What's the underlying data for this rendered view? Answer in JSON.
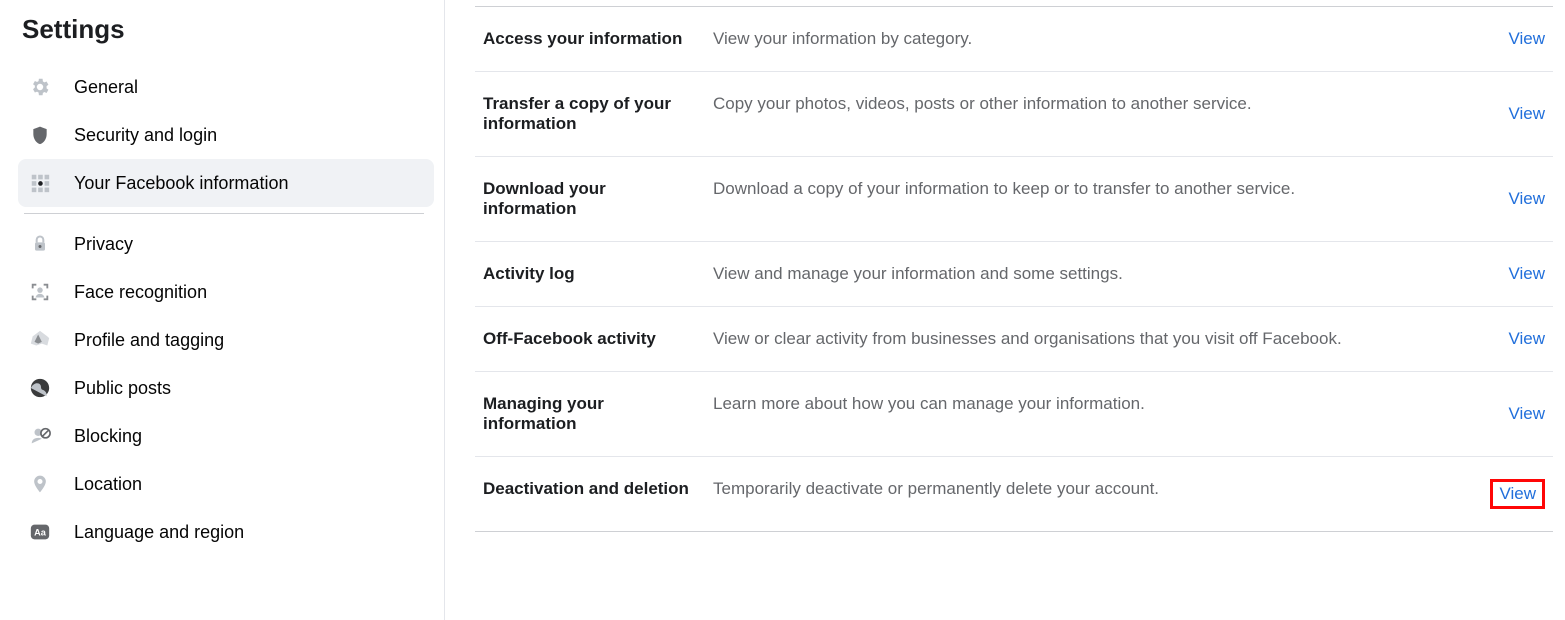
{
  "sidebar": {
    "title": "Settings",
    "items": [
      {
        "label": "General"
      },
      {
        "label": "Security and login"
      },
      {
        "label": "Your Facebook information"
      },
      {
        "label": "Privacy"
      },
      {
        "label": "Face recognition"
      },
      {
        "label": "Profile and tagging"
      },
      {
        "label": "Public posts"
      },
      {
        "label": "Blocking"
      },
      {
        "label": "Location"
      },
      {
        "label": "Language and region"
      }
    ]
  },
  "main": {
    "rows": [
      {
        "title": "Access your information",
        "desc": "View your information by category.",
        "action": "View"
      },
      {
        "title": "Transfer a copy of your information",
        "desc": "Copy your photos, videos, posts or other information to another service.",
        "action": "View"
      },
      {
        "title": "Download your information",
        "desc": "Download a copy of your information to keep or to transfer to another service.",
        "action": "View"
      },
      {
        "title": "Activity log",
        "desc": "View and manage your information and some settings.",
        "action": "View"
      },
      {
        "title": "Off-Facebook activity",
        "desc": "View or clear activity from businesses and organisations that you visit off Facebook.",
        "action": "View"
      },
      {
        "title": "Managing your information",
        "desc": "Learn more about how you can manage your information.",
        "action": "View"
      },
      {
        "title": "Deactivation and deletion",
        "desc": "Temporarily deactivate or permanently delete your account.",
        "action": "View"
      }
    ]
  }
}
